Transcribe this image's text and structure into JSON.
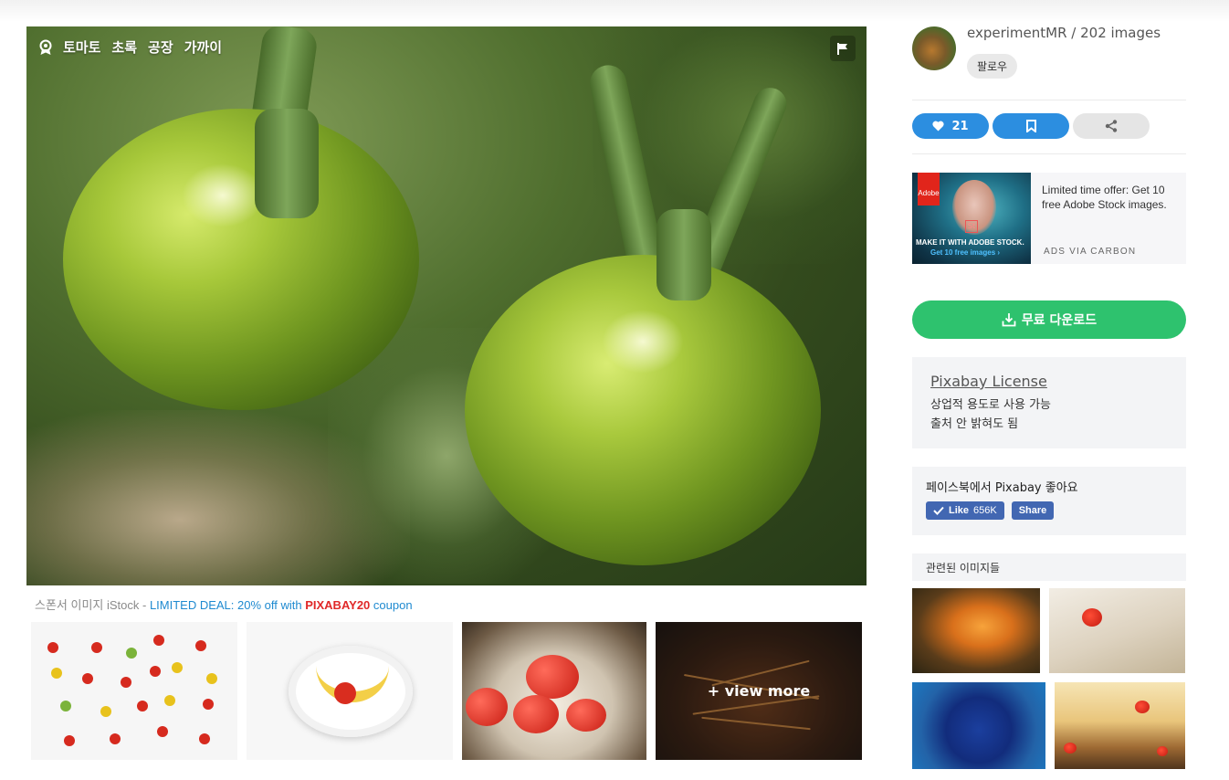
{
  "photo": {
    "tags": [
      "토마토",
      "초록",
      "공장",
      "가까이"
    ]
  },
  "sponsor": {
    "prefix": "스폰서 이미지 iStock - ",
    "deal": "LIMITED DEAL: 20% off with ",
    "code": "PIXABAY20",
    "suffix": " coupon"
  },
  "related_row": {
    "view_more": "+ view more"
  },
  "author": {
    "name_count": "experimentMR / 202 images",
    "follow_label": "팔로우"
  },
  "actions": {
    "like_count": "21"
  },
  "ad": {
    "logo_text": "Adobe",
    "badge": "St",
    "image_line1": "MAKE IT WITH ADOBE STOCK.",
    "image_line2": "Get 10 free images ›",
    "text": "Limited time offer: Get 10 free Adobe Stock images.",
    "via": "ADS VIA CARBON"
  },
  "download": {
    "label": "무료 다운로드"
  },
  "license": {
    "title": "Pixabay License",
    "line1": "상업적 용도로 사용 가능",
    "line2": "출처 안 밝혀도 됨"
  },
  "facebook": {
    "text": "페이스북에서 Pixabay 좋아요",
    "like_label": "Like",
    "like_count": "656K",
    "share_label": "Share"
  },
  "related": {
    "heading": "관련된 이미지들"
  },
  "colors": {
    "accent_blue": "#2c8ee0",
    "download_green": "#2ec26e",
    "coupon_red": "#e02828",
    "facebook_blue": "#4267b2"
  }
}
